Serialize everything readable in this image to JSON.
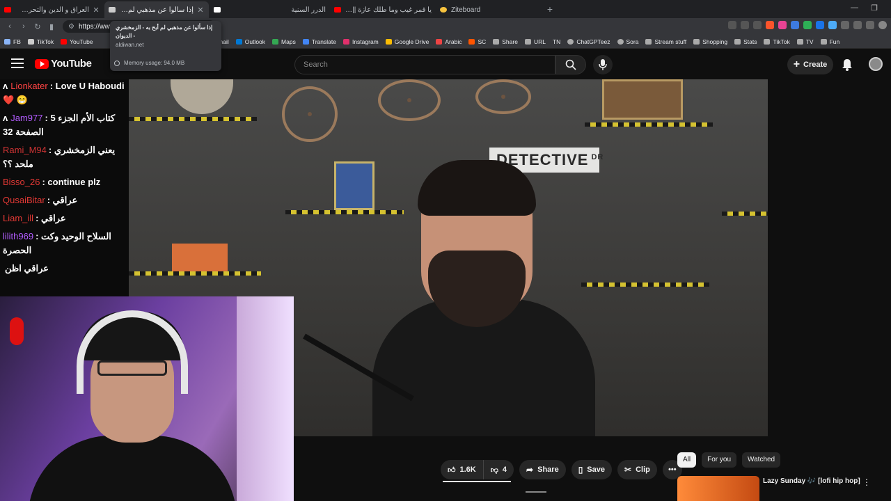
{
  "browser": {
    "tabs": [
      {
        "title": "العراق و الدين والتحرش الحقيقة ا",
        "color": "#ff0000",
        "active": false
      },
      {
        "title": "إذا سألوا عن مذهبي لم أبح به - ال",
        "color": "#cccccc",
        "active": true
      },
      {
        "title": "",
        "color": "#ffffff",
        "active": false
      },
      {
        "title": "الدرر السنية",
        "color": "#1a6",
        "active": false
      },
      {
        "title": "يا قمر غيب وما طلك عازة || شفت الفرا",
        "color": "#ff0000",
        "active": false
      },
      {
        "title": "Ziteboard",
        "color": "#f6c23e",
        "active": false
      }
    ],
    "new_tab": "+",
    "address": "https://www",
    "tooltip": {
      "title": "إذا سألوا عن مذهبي لم أبح به - الزمخشري - الديوان",
      "domain": "aldiwan.net",
      "memory": "Memory usage: 94.0 MB"
    },
    "bookmarks": [
      {
        "label": "FB",
        "color": "#8ab4f8"
      },
      {
        "label": "TikTok",
        "color": "#cccccc"
      },
      {
        "label": "YouTube",
        "color": "#ff0000"
      },
      {
        "label": "Gmail",
        "color": "#ea4335"
      },
      {
        "label": "Outlook",
        "color": "#0078d4"
      },
      {
        "label": "Maps",
        "color": "#34a853"
      },
      {
        "label": "Translate",
        "color": "#4285f4"
      },
      {
        "label": "Instagram",
        "color": "#e1306c"
      },
      {
        "label": "Google Drive",
        "color": "#fbbc04"
      },
      {
        "label": "Arabic",
        "color": "#e44"
      },
      {
        "label": "SC",
        "color": "#ff5500"
      },
      {
        "label": "Share",
        "color": "#aaaaaa"
      },
      {
        "label": "URL",
        "color": "#aaaaaa"
      },
      {
        "label": "TN",
        "color": "#aaaaaa"
      },
      {
        "label": "ChatGPTeez",
        "color": "#aaaaaa"
      },
      {
        "label": "Sora",
        "color": "#aaaaaa"
      },
      {
        "label": "Stream stuff",
        "color": "#aaaaaa"
      },
      {
        "label": "Shopping",
        "color": "#aaaaaa"
      },
      {
        "label": "Stats",
        "color": "#aaaaaa"
      },
      {
        "label": "TikTok",
        "color": "#aaaaaa"
      },
      {
        "label": "TV",
        "color": "#aaaaaa"
      },
      {
        "label": "Fun",
        "color": "#aaaaaa"
      }
    ]
  },
  "youtube": {
    "logo": "YouTube",
    "search_placeholder": "Search",
    "create_label": "Create",
    "video": {
      "sign_text": "DETECTIVE",
      "sign_sup": "DR"
    },
    "actions": {
      "likes": "1.6K",
      "dislikes": "4",
      "share": "Share",
      "save": "Save",
      "clip": "Clip",
      "more": "•••"
    },
    "chips": [
      "All",
      "For you",
      "Watched"
    ],
    "recommendation": {
      "title": "Lazy Sunday 🎶 [lofi hip hop]"
    }
  },
  "chat": {
    "messages": [
      {
        "user": "Lionkater",
        "user_color": "#ff4444",
        "prefix": "ʌ",
        "text": ": Love U Haboudi ❤️ 😁"
      },
      {
        "user": "Jam977",
        "user_color": "#b35cff",
        "prefix": "ʌ",
        "text": ": كتاب الأم الجزء 5 الصفحة 32"
      },
      {
        "user": "Rami_M94",
        "user_color": "#cc3333",
        "prefix": "",
        "text": ": يعني الزمخشري ملحد ؟؟"
      },
      {
        "user": "Bisso_26",
        "user_color": "#e53935",
        "prefix": "",
        "text": ": continue plz"
      },
      {
        "user": "QusaiBitar",
        "user_color": "#e53935",
        "prefix": "",
        "text": ": عراقي"
      },
      {
        "user": "Liam_ill",
        "user_color": "#e53935",
        "prefix": "",
        "text": ": عراقي"
      },
      {
        "user": "lilith969",
        "user_color": "#b35cff",
        "prefix": "",
        "text": ": السلاح الوحيد وكت الحصرة"
      },
      {
        "user": "",
        "user_color": "#ffffff",
        "prefix": "",
        "text": "عراقي اظن"
      }
    ]
  }
}
